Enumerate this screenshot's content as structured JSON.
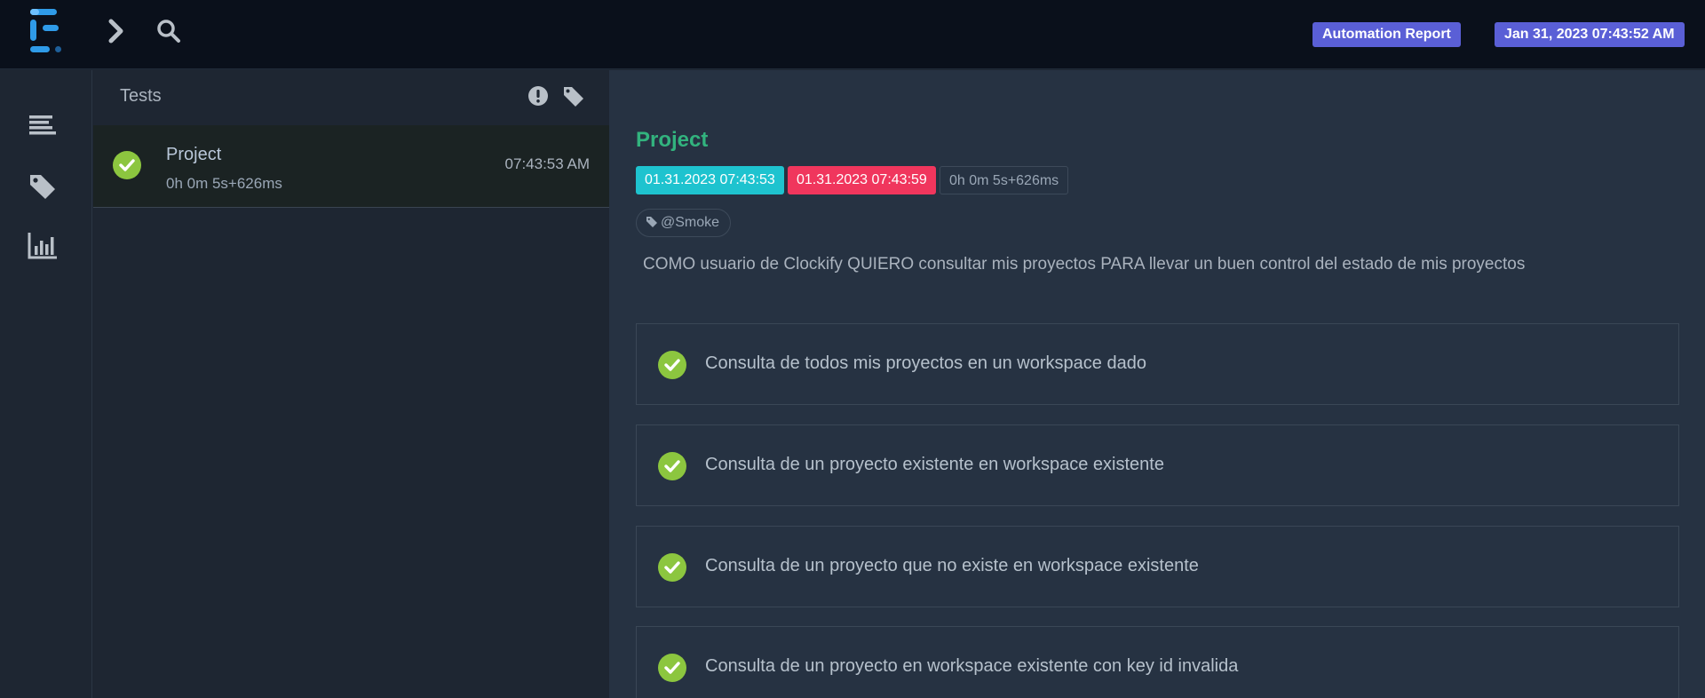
{
  "navbar": {
    "report_label": "Automation Report",
    "date_label": "Jan 31, 2023 07:43:52 AM"
  },
  "rail": {
    "icons": [
      "dashboard-icon",
      "tag-icon",
      "bar-chart-icon"
    ]
  },
  "test_panel": {
    "title": "Tests",
    "tests": [
      {
        "name": "Project",
        "duration": "0h 0m 5s+626ms",
        "time": "07:43:53 AM",
        "status": "pass"
      }
    ]
  },
  "detail": {
    "title": "Project",
    "start": "01.31.2023 07:43:53",
    "end": "01.31.2023 07:43:59",
    "duration": "0h 0m 5s+626ms",
    "tag": "@Smoke",
    "description": "COMO usuario de Clockify QUIERO consultar mis proyectos PARA llevar un buen control del estado de mis proyectos",
    "steps": [
      {
        "label": "Consulta de todos mis proyectos en un workspace dado",
        "status": "pass"
      },
      {
        "label": "Consulta de un proyecto existente en workspace existente",
        "status": "pass"
      },
      {
        "label": "Consulta de un proyecto que no existe en workspace existente",
        "status": "pass"
      },
      {
        "label": "Consulta de un proyecto en workspace existente con key id invalida",
        "status": "pass"
      }
    ]
  },
  "colors": {
    "pass": "#8cc63f",
    "accent": "#5a5fd6",
    "start_tag": "#1ec3cf",
    "end_tag": "#f0365d",
    "title_green": "#32b37e"
  }
}
